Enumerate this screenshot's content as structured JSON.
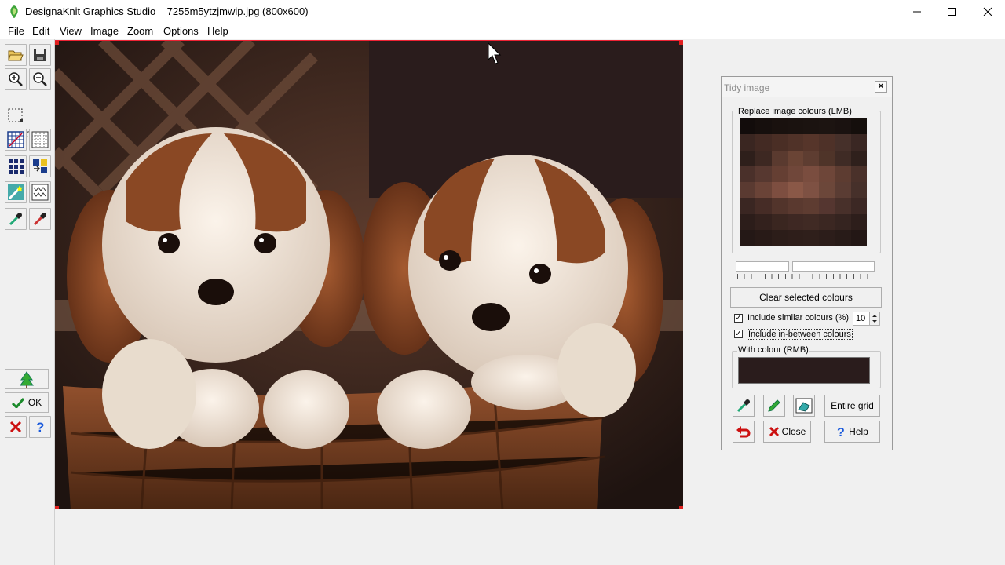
{
  "window": {
    "app_name": "DesignaKnit Graphics Studio",
    "file_name": "7255m5ytzjmwip.jpg (800x600)",
    "title_full": "DesignaKnit Graphics Studio    7255m5ytzjmwip.jpg (800x600)"
  },
  "menu": [
    "File",
    "Edit",
    "View",
    "Image",
    "Zoom",
    "Options",
    "Help"
  ],
  "toolbar": {
    "zoom_level": "100%",
    "ok_label": "OK",
    "icons": [
      "open-icon",
      "save-icon",
      "zoom-in-icon",
      "zoom-out-icon",
      "select-rect-icon",
      "grid-icon",
      "dotted-grid-icon",
      "tile-icon",
      "color-swap-icon",
      "wand-icon",
      "stitch-icon",
      "eyedropper-icon",
      "eyedropper-alt-icon",
      "tree-icon",
      "ok-check-icon",
      "cancel-x-icon",
      "help-icon"
    ]
  },
  "dialog": {
    "title": "Tidy image",
    "replace_group_label": "Replace image colours (LMB)",
    "clear_button": "Clear selected colours",
    "include_similar_label": "Include similar colours (%)",
    "include_similar_checked": true,
    "similar_value": "10",
    "include_between_label": "Include in-between colours",
    "include_between_checked": true,
    "with_colour_label": "With colour (RMB)",
    "with_colour_hex": "#2a1c1c",
    "entire_grid_button": "Entire grid",
    "close_button": "Close",
    "help_button": "Help",
    "palette": [
      "#120c0b",
      "#160f0d",
      "#19110e",
      "#1a120f",
      "#1b1310",
      "#1c1411",
      "#1a1210",
      "#150f0c",
      "#3a2621",
      "#432a23",
      "#4a2e25",
      "#503228",
      "#56352a",
      "#4e3128",
      "#46302a",
      "#3a2723",
      "#2e1f1b",
      "#3d2822",
      "#5a3a2f",
      "#6a4435",
      "#5e3d31",
      "#4f3429",
      "#3f2b25",
      "#2f201c",
      "#4a302a",
      "#573830",
      "#653f33",
      "#70473a",
      "#7a4d3f",
      "#6e4639",
      "#5d3c31",
      "#4a312a",
      "#5a3a31",
      "#6a4337",
      "#7d4e40",
      "#8a5847",
      "#7e5143",
      "#6c473a",
      "#5a3c33",
      "#46302a",
      "#3a2622",
      "#462c26",
      "#52342b",
      "#5a392f",
      "#5e3c31",
      "#553630",
      "#48302a",
      "#3c2824",
      "#2c1d1a",
      "#33211d",
      "#3a2620",
      "#3e2823",
      "#402a24",
      "#3b2722",
      "#352420",
      "#2d1e1b",
      "#241816",
      "#281a17",
      "#2c1d19",
      "#2e1e1a",
      "#2f1f1b",
      "#2c1d1a",
      "#281b18",
      "#231715"
    ]
  }
}
